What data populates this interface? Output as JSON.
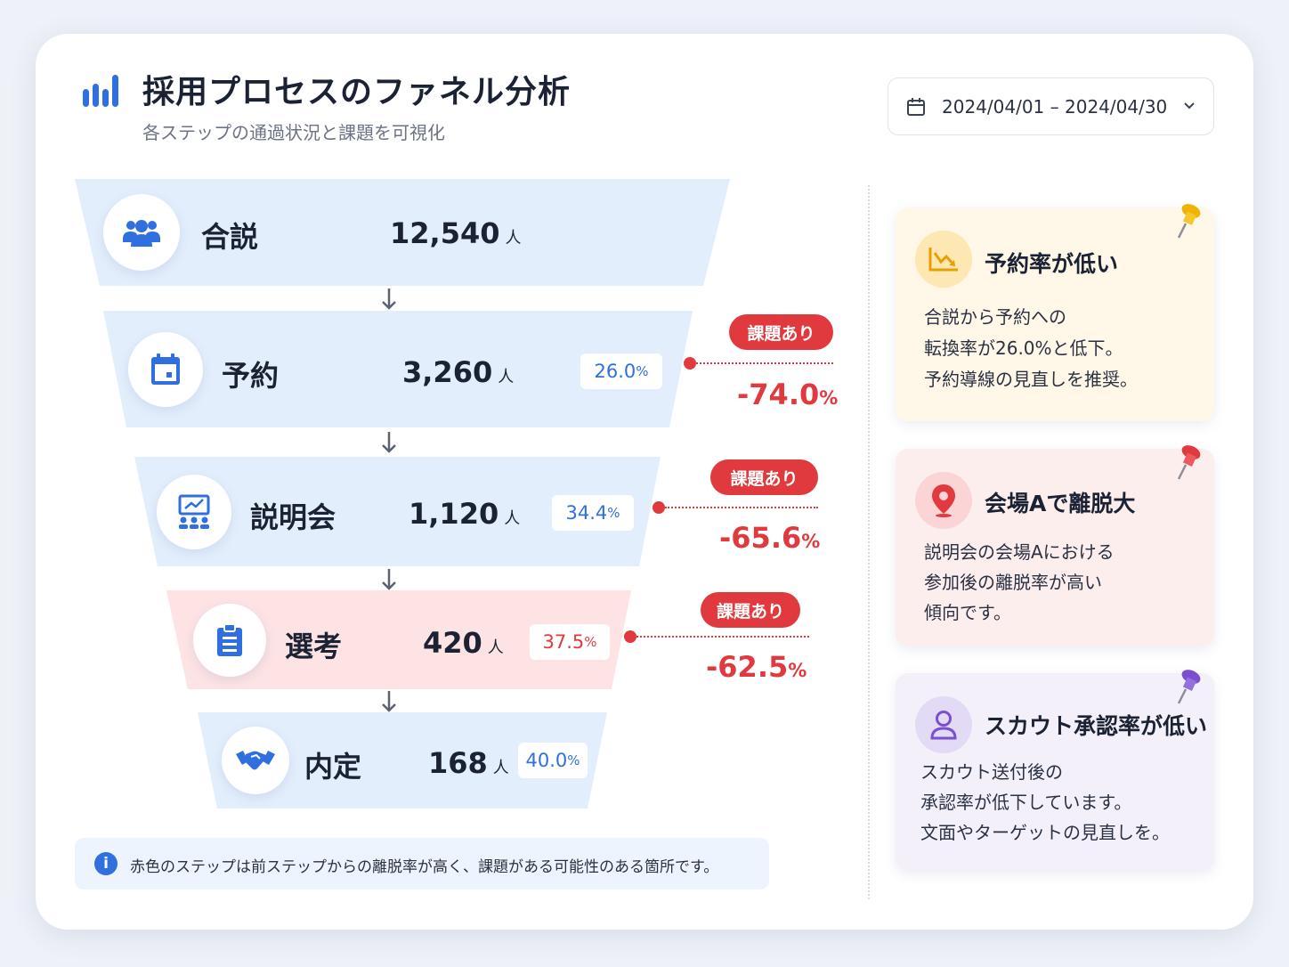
{
  "header": {
    "title": "採用プロセスのファネル分析",
    "subtitle": "各ステップの通過状況と課題を可視化"
  },
  "date_range": {
    "value": "2024/04/01 – 2024/04/30"
  },
  "funnel": {
    "stages": [
      {
        "label": "合説",
        "count": "12,540",
        "unit": "人",
        "icon": "people-group-icon"
      },
      {
        "label": "予約",
        "count": "3,260",
        "unit": "人",
        "rate": "26.0",
        "rate_unit": "%",
        "icon": "calendar-icon"
      },
      {
        "label": "説明会",
        "count": "1,120",
        "unit": "人",
        "rate": "34.4",
        "rate_unit": "%",
        "icon": "presentation-icon"
      },
      {
        "label": "選考",
        "count": "420",
        "unit": "人",
        "rate": "37.5",
        "rate_unit": "%",
        "icon": "clipboard-icon",
        "highlight": "#fde3e4"
      },
      {
        "label": "内定",
        "count": "168",
        "unit": "人",
        "rate": "40.0",
        "rate_unit": "%",
        "icon": "handshake-icon"
      }
    ],
    "issues": [
      {
        "badge": "課題あり",
        "drop": "-74.0",
        "unit": "%"
      },
      {
        "badge": "課題あり",
        "drop": "-65.6",
        "unit": "%"
      },
      {
        "badge": "課題あり",
        "drop": "-62.5",
        "unit": "%"
      }
    ]
  },
  "info": {
    "text": "赤色のステップは前ステップからの離脱率が高く、課題がある可能性のある箇所です。"
  },
  "notes": [
    {
      "title": "予約率が低い",
      "lines": [
        "合説から予約への",
        "転換率が26.0%と低下。",
        "予約導線の見直しを推奨。"
      ],
      "icon": "chart-down-icon",
      "bg": "#fff8e8",
      "pin_color": "#f0b400"
    },
    {
      "title": "会場Aで離脱大",
      "lines": [
        "説明会の会場Aにおける",
        "参加後の離脱率が高い",
        "傾向です。"
      ],
      "icon": "location-pin-icon",
      "bg": "#fdeeee",
      "pin_color": "#e03a3f"
    },
    {
      "title": "スカウト承認率が低い",
      "lines": [
        "スカウト送付後の",
        "承認率が低下しています。",
        "文面やターゲットの見直しを。"
      ],
      "icon": "user-icon",
      "bg": "#f3f0fa",
      "pin_color": "#7b4fd0"
    }
  ],
  "colors": {
    "accent": "#2f6fe0",
    "danger": "#e03a3f",
    "stage_bg": "#e3eefc"
  }
}
